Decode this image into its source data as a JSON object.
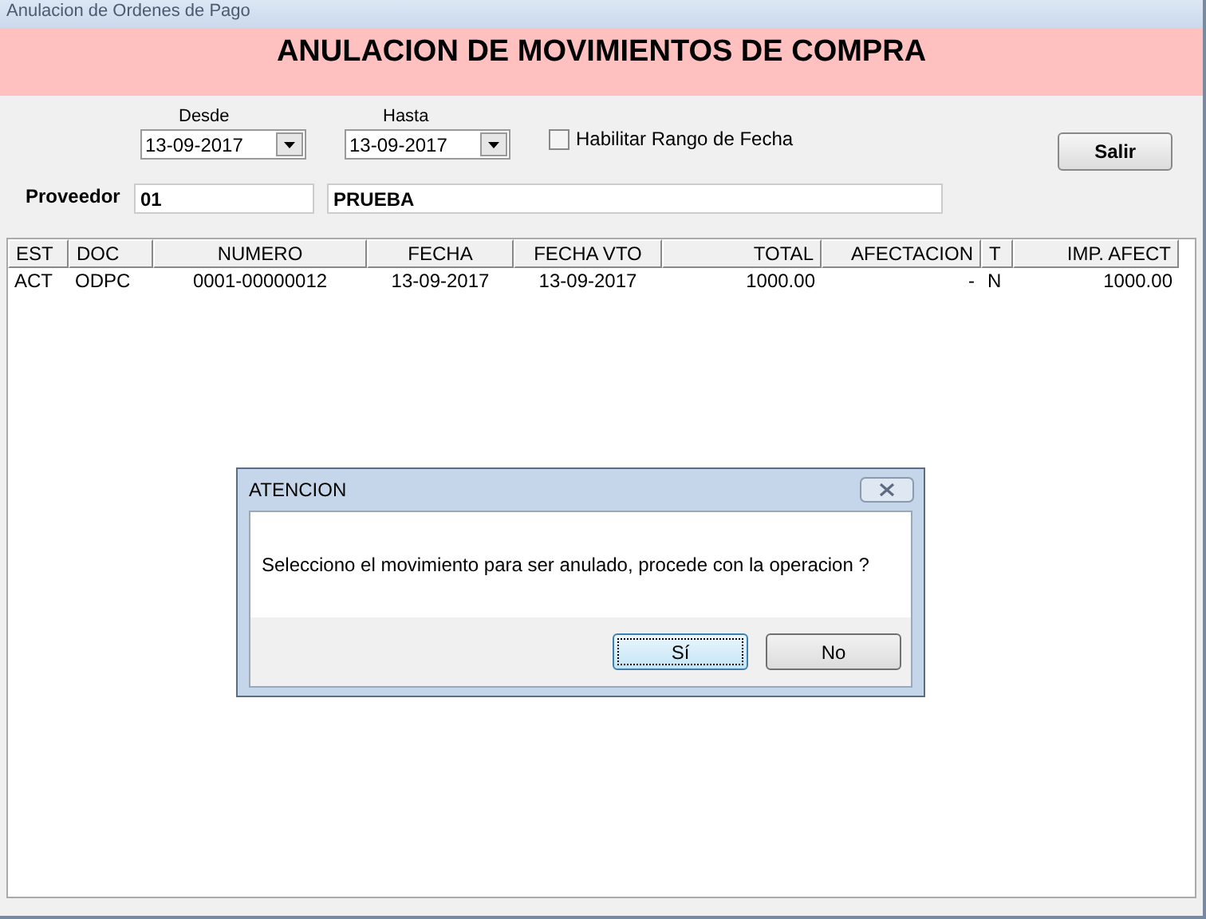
{
  "window": {
    "title": "Anulacion de Ordenes de Pago"
  },
  "header": {
    "title": "ANULACION DE MOVIMIENTOS DE COMPRA"
  },
  "filters": {
    "desde": {
      "label": "Desde",
      "value": "13-09-2017"
    },
    "hasta": {
      "label": "Hasta",
      "value": "13-09-2017"
    },
    "range_checkbox": {
      "label": "Habilitar Rango de Fecha",
      "checked": false
    }
  },
  "exit_button": "Salir",
  "proveedor": {
    "label": "Proveedor",
    "code": "01",
    "name": "PRUEBA"
  },
  "table": {
    "columns": [
      "EST",
      "DOC",
      "NUMERO",
      "FECHA",
      "FECHA VTO",
      "TOTAL",
      "AFECTACION",
      "T",
      "IMP. AFECT"
    ],
    "rows": [
      [
        "ACT",
        "ODPC",
        "0001-00000012",
        "13-09-2017",
        "13-09-2017",
        "1000.00",
        "-",
        "N",
        "1000.00"
      ]
    ]
  },
  "dialog": {
    "title": "ATENCION",
    "message": "Selecciono el movimiento para ser anulado, procede con la operacion ?",
    "buttons": [
      {
        "label": "Sí",
        "default": true
      },
      {
        "label": "No",
        "default": false
      }
    ]
  }
}
